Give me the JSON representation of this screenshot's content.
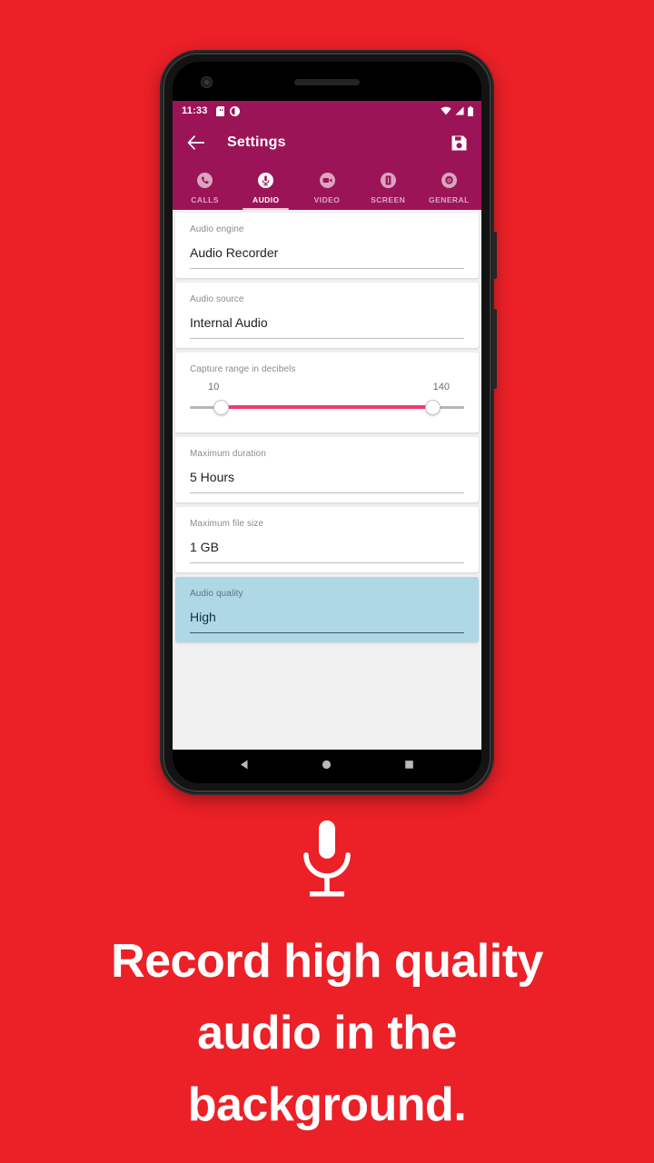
{
  "page": {
    "background_color": "#ec2027"
  },
  "phone": {
    "statusbar": {
      "time": "11:33",
      "left_icons": [
        "sd-card-icon",
        "app-notification-icon"
      ],
      "right_icons": [
        "wifi-icon",
        "cell-signal-icon",
        "battery-icon"
      ]
    },
    "appbar": {
      "back_icon": "arrow-left-icon",
      "title": "Settings",
      "action_icon": "save-floppy-icon",
      "background_color": "#9c1458"
    },
    "tabs": [
      {
        "label": "CALLS",
        "icon": "phone-icon",
        "active": false
      },
      {
        "label": "AUDIO",
        "icon": "microphone-icon",
        "active": true
      },
      {
        "label": "VIDEO",
        "icon": "video-cam-icon",
        "active": false
      },
      {
        "label": "SCREEN",
        "icon": "screen-icon",
        "active": false
      },
      {
        "label": "GENERAL",
        "icon": "gear-icon",
        "active": false
      }
    ],
    "settings": [
      {
        "label": "Audio engine",
        "value": "Audio Recorder",
        "type": "select",
        "highlighted": false
      },
      {
        "label": "Audio source",
        "value": "Internal Audio",
        "type": "select",
        "highlighted": false
      },
      {
        "label": "Capture range in decibels",
        "type": "range-slider",
        "min_value": "10",
        "max_value": "140",
        "track_color": "#f03a6e",
        "highlighted": false
      },
      {
        "label": "Maximum duration",
        "value": "5 Hours",
        "type": "select",
        "highlighted": false
      },
      {
        "label": "Maximum file size",
        "value": "1 GB",
        "type": "select",
        "highlighted": false
      },
      {
        "label": "Audio quality",
        "value": "High",
        "type": "select",
        "highlighted": true,
        "highlight_color": "#aed8e6"
      }
    ],
    "navbar": {
      "back_icon": "nav-back-triangle-icon",
      "home_icon": "nav-home-circle-icon",
      "recents_icon": "nav-recents-square-icon"
    }
  },
  "promo": {
    "icon": "microphone-icon",
    "headline": "Record high quality audio in the background.",
    "text_color": "#ffffff"
  }
}
